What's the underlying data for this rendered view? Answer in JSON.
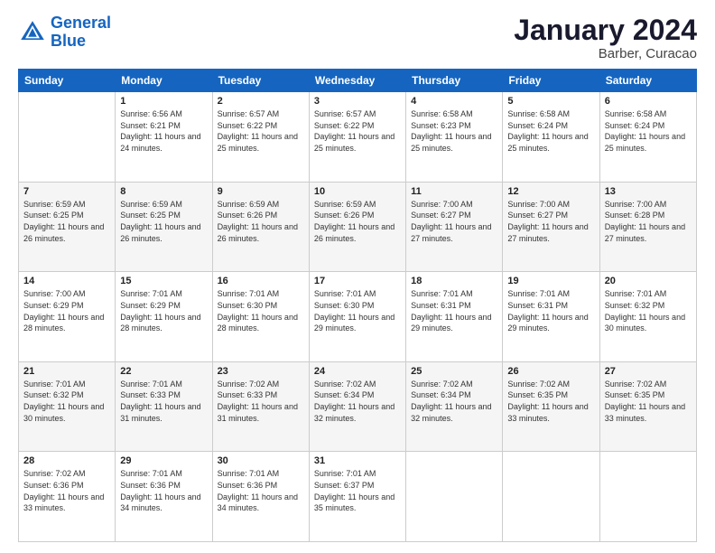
{
  "logo": {
    "line1": "General",
    "line2": "Blue"
  },
  "title": "January 2024",
  "subtitle": "Barber, Curacao",
  "header": {
    "days": [
      "Sunday",
      "Monday",
      "Tuesday",
      "Wednesday",
      "Thursday",
      "Friday",
      "Saturday"
    ]
  },
  "weeks": [
    [
      {
        "day": "",
        "sunrise": "",
        "sunset": "",
        "daylight": ""
      },
      {
        "day": "1",
        "sunrise": "Sunrise: 6:56 AM",
        "sunset": "Sunset: 6:21 PM",
        "daylight": "Daylight: 11 hours and 24 minutes."
      },
      {
        "day": "2",
        "sunrise": "Sunrise: 6:57 AM",
        "sunset": "Sunset: 6:22 PM",
        "daylight": "Daylight: 11 hours and 25 minutes."
      },
      {
        "day": "3",
        "sunrise": "Sunrise: 6:57 AM",
        "sunset": "Sunset: 6:22 PM",
        "daylight": "Daylight: 11 hours and 25 minutes."
      },
      {
        "day": "4",
        "sunrise": "Sunrise: 6:58 AM",
        "sunset": "Sunset: 6:23 PM",
        "daylight": "Daylight: 11 hours and 25 minutes."
      },
      {
        "day": "5",
        "sunrise": "Sunrise: 6:58 AM",
        "sunset": "Sunset: 6:24 PM",
        "daylight": "Daylight: 11 hours and 25 minutes."
      },
      {
        "day": "6",
        "sunrise": "Sunrise: 6:58 AM",
        "sunset": "Sunset: 6:24 PM",
        "daylight": "Daylight: 11 hours and 25 minutes."
      }
    ],
    [
      {
        "day": "7",
        "sunrise": "Sunrise: 6:59 AM",
        "sunset": "Sunset: 6:25 PM",
        "daylight": "Daylight: 11 hours and 26 minutes."
      },
      {
        "day": "8",
        "sunrise": "Sunrise: 6:59 AM",
        "sunset": "Sunset: 6:25 PM",
        "daylight": "Daylight: 11 hours and 26 minutes."
      },
      {
        "day": "9",
        "sunrise": "Sunrise: 6:59 AM",
        "sunset": "Sunset: 6:26 PM",
        "daylight": "Daylight: 11 hours and 26 minutes."
      },
      {
        "day": "10",
        "sunrise": "Sunrise: 6:59 AM",
        "sunset": "Sunset: 6:26 PM",
        "daylight": "Daylight: 11 hours and 26 minutes."
      },
      {
        "day": "11",
        "sunrise": "Sunrise: 7:00 AM",
        "sunset": "Sunset: 6:27 PM",
        "daylight": "Daylight: 11 hours and 27 minutes."
      },
      {
        "day": "12",
        "sunrise": "Sunrise: 7:00 AM",
        "sunset": "Sunset: 6:27 PM",
        "daylight": "Daylight: 11 hours and 27 minutes."
      },
      {
        "day": "13",
        "sunrise": "Sunrise: 7:00 AM",
        "sunset": "Sunset: 6:28 PM",
        "daylight": "Daylight: 11 hours and 27 minutes."
      }
    ],
    [
      {
        "day": "14",
        "sunrise": "Sunrise: 7:00 AM",
        "sunset": "Sunset: 6:29 PM",
        "daylight": "Daylight: 11 hours and 28 minutes."
      },
      {
        "day": "15",
        "sunrise": "Sunrise: 7:01 AM",
        "sunset": "Sunset: 6:29 PM",
        "daylight": "Daylight: 11 hours and 28 minutes."
      },
      {
        "day": "16",
        "sunrise": "Sunrise: 7:01 AM",
        "sunset": "Sunset: 6:30 PM",
        "daylight": "Daylight: 11 hours and 28 minutes."
      },
      {
        "day": "17",
        "sunrise": "Sunrise: 7:01 AM",
        "sunset": "Sunset: 6:30 PM",
        "daylight": "Daylight: 11 hours and 29 minutes."
      },
      {
        "day": "18",
        "sunrise": "Sunrise: 7:01 AM",
        "sunset": "Sunset: 6:31 PM",
        "daylight": "Daylight: 11 hours and 29 minutes."
      },
      {
        "day": "19",
        "sunrise": "Sunrise: 7:01 AM",
        "sunset": "Sunset: 6:31 PM",
        "daylight": "Daylight: 11 hours and 29 minutes."
      },
      {
        "day": "20",
        "sunrise": "Sunrise: 7:01 AM",
        "sunset": "Sunset: 6:32 PM",
        "daylight": "Daylight: 11 hours and 30 minutes."
      }
    ],
    [
      {
        "day": "21",
        "sunrise": "Sunrise: 7:01 AM",
        "sunset": "Sunset: 6:32 PM",
        "daylight": "Daylight: 11 hours and 30 minutes."
      },
      {
        "day": "22",
        "sunrise": "Sunrise: 7:01 AM",
        "sunset": "Sunset: 6:33 PM",
        "daylight": "Daylight: 11 hours and 31 minutes."
      },
      {
        "day": "23",
        "sunrise": "Sunrise: 7:02 AM",
        "sunset": "Sunset: 6:33 PM",
        "daylight": "Daylight: 11 hours and 31 minutes."
      },
      {
        "day": "24",
        "sunrise": "Sunrise: 7:02 AM",
        "sunset": "Sunset: 6:34 PM",
        "daylight": "Daylight: 11 hours and 32 minutes."
      },
      {
        "day": "25",
        "sunrise": "Sunrise: 7:02 AM",
        "sunset": "Sunset: 6:34 PM",
        "daylight": "Daylight: 11 hours and 32 minutes."
      },
      {
        "day": "26",
        "sunrise": "Sunrise: 7:02 AM",
        "sunset": "Sunset: 6:35 PM",
        "daylight": "Daylight: 11 hours and 33 minutes."
      },
      {
        "day": "27",
        "sunrise": "Sunrise: 7:02 AM",
        "sunset": "Sunset: 6:35 PM",
        "daylight": "Daylight: 11 hours and 33 minutes."
      }
    ],
    [
      {
        "day": "28",
        "sunrise": "Sunrise: 7:02 AM",
        "sunset": "Sunset: 6:36 PM",
        "daylight": "Daylight: 11 hours and 33 minutes."
      },
      {
        "day": "29",
        "sunrise": "Sunrise: 7:01 AM",
        "sunset": "Sunset: 6:36 PM",
        "daylight": "Daylight: 11 hours and 34 minutes."
      },
      {
        "day": "30",
        "sunrise": "Sunrise: 7:01 AM",
        "sunset": "Sunset: 6:36 PM",
        "daylight": "Daylight: 11 hours and 34 minutes."
      },
      {
        "day": "31",
        "sunrise": "Sunrise: 7:01 AM",
        "sunset": "Sunset: 6:37 PM",
        "daylight": "Daylight: 11 hours and 35 minutes."
      },
      {
        "day": "",
        "sunrise": "",
        "sunset": "",
        "daylight": ""
      },
      {
        "day": "",
        "sunrise": "",
        "sunset": "",
        "daylight": ""
      },
      {
        "day": "",
        "sunrise": "",
        "sunset": "",
        "daylight": ""
      }
    ]
  ]
}
